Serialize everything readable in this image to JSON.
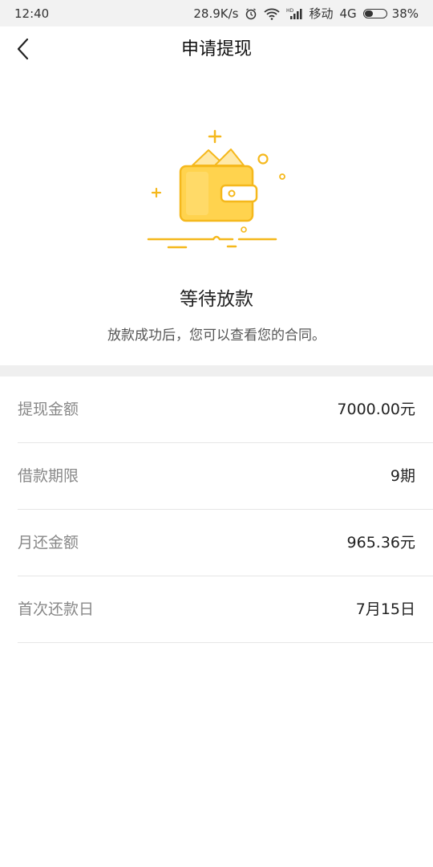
{
  "status_bar": {
    "time": "12:40",
    "speed": "28.9K/s",
    "carrier": "移动",
    "network": "4G",
    "battery_percent": "38%",
    "battery_level": 0.38,
    "icons": [
      "alarm-icon",
      "wifi-icon",
      "hd-signal-icon",
      "battery-icon"
    ]
  },
  "nav": {
    "title": "申请提现",
    "back_icon": "chevron-left-icon"
  },
  "hero": {
    "illustration": "wallet-icon",
    "title": "等待放款",
    "subtitle": "放款成功后，您可以查看您的合同。",
    "accent_color": "#f5b81c",
    "fill_color": "#ffd34e"
  },
  "details": [
    {
      "label": "提现金额",
      "value": "7000.00元"
    },
    {
      "label": "借款期限",
      "value": "9期"
    },
    {
      "label": "月还金额",
      "value": "965.36元"
    },
    {
      "label": "首次还款日",
      "value": "7月15日"
    }
  ]
}
